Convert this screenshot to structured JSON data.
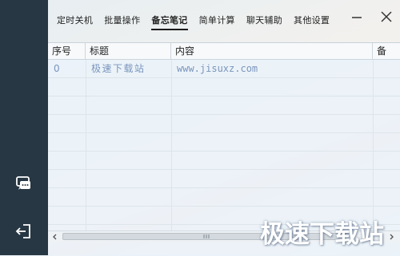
{
  "sidebar": {
    "chat_icon": "chat-bubble-icon",
    "exit_icon": "exit-icon",
    "background": "#273743"
  },
  "tabs": [
    {
      "label": "定时关机"
    },
    {
      "label": "批量操作"
    },
    {
      "label": "备忘笔记"
    },
    {
      "label": "简单计算"
    },
    {
      "label": "聊天辅助"
    },
    {
      "label": "其他设置"
    }
  ],
  "active_tab": "备忘笔记",
  "window": {
    "minimize_icon": "minimize-icon",
    "close_icon": "close-icon"
  },
  "table": {
    "columns": [
      "序号",
      "标题",
      "内容",
      "备"
    ],
    "rows": [
      {
        "index": "0",
        "title": "极速下载站",
        "content": "www.jisuxz.com"
      }
    ],
    "text_color": "#7a95bd"
  },
  "scrollbar": {
    "left_arrow": "arrow-left-icon",
    "right_arrow": "arrow-right-icon"
  },
  "watermark": "极速下载站"
}
